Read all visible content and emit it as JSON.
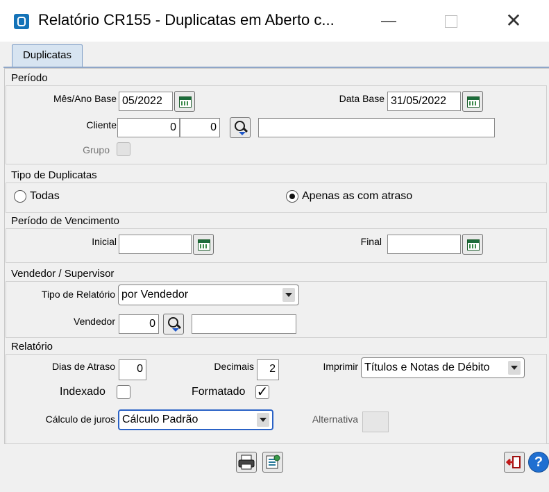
{
  "window": {
    "title": "Relatório CR155 - Duplicatas em Aberto c...",
    "min_icon": "minimize-icon",
    "max_icon": "maximize-icon",
    "close_icon": "close-icon"
  },
  "tabs": [
    {
      "label": "Duplicatas"
    }
  ],
  "periodo": {
    "title": "Período",
    "mes_ano_label": "Mês/Ano Base",
    "mes_ano_value": "05/2022",
    "data_base_label": "Data Base",
    "data_base_value": "31/05/2022",
    "cliente_label": "Cliente",
    "cliente_code": "0",
    "cliente_sub": "0",
    "cliente_name": "",
    "grupo_label": "Grupo"
  },
  "tipo": {
    "title": "Tipo de Duplicatas",
    "todas_label": "Todas",
    "atraso_label": "Apenas as com atraso",
    "selected": "Apenas as com atraso"
  },
  "vencimento": {
    "title": "Período de Vencimento",
    "inicial_label": "Inicial",
    "inicial_value": "",
    "final_label": "Final",
    "final_value": ""
  },
  "vendedor": {
    "title": "Vendedor / Supervisor",
    "tipo_label": "Tipo de Relatório",
    "tipo_value": "por Vendedor",
    "vendedor_label": "Vendedor",
    "vendedor_code": "0",
    "vendedor_name": ""
  },
  "relatorio": {
    "title": "Relatório",
    "dias_label": "Dias de Atraso",
    "dias_value": "0",
    "decimais_label": "Decimais",
    "decimais_value": "2",
    "imprimir_label": "Imprimir",
    "imprimir_value": "Títulos e Notas de Débito",
    "indexado_label": "Indexado",
    "indexado_checked": false,
    "formatado_label": "Formatado",
    "formatado_checked": true,
    "juros_label": "Cálculo de juros",
    "juros_value": "Cálculo Padrão",
    "alternativa_label": "Alternativa"
  },
  "footer": {
    "print_icon": "printer-icon",
    "config_icon": "settings-icon",
    "exit_icon": "exit-icon",
    "help_icon": "help-icon",
    "check_glyph": "✓",
    "help_glyph": "?"
  }
}
